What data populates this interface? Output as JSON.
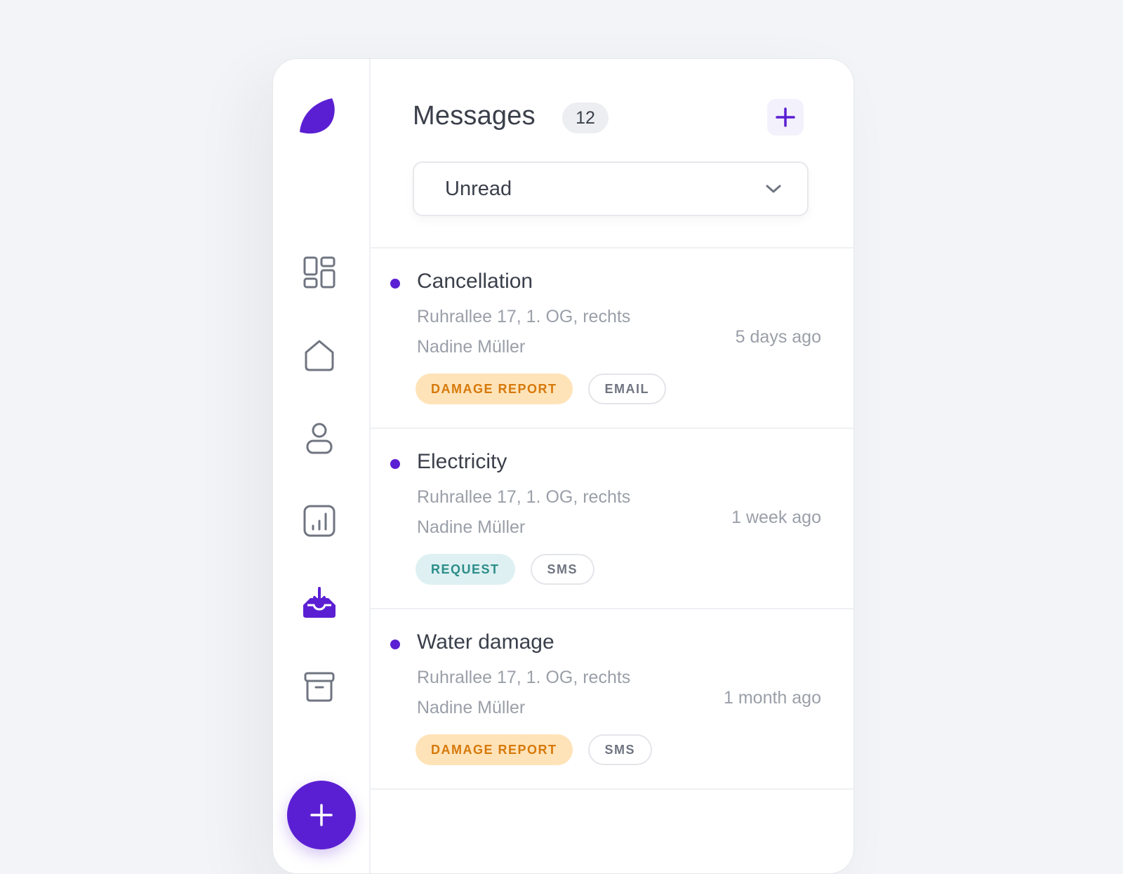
{
  "colors": {
    "accent": "#5b1fd3",
    "damage_tag_bg": "#ffe3b8",
    "damage_tag_text": "#d6790a",
    "request_tag_bg": "#def0f2",
    "request_tag_text": "#2c8d89"
  },
  "sidebar": {
    "logo": "leaf-logo-icon",
    "nav": [
      {
        "icon": "dashboard-icon",
        "active": false
      },
      {
        "icon": "home-icon",
        "active": false
      },
      {
        "icon": "user-icon",
        "active": false
      },
      {
        "icon": "chart-icon",
        "active": false
      },
      {
        "icon": "inbox-icon",
        "active": true
      },
      {
        "icon": "archive-icon",
        "active": false
      }
    ],
    "fab_icon": "plus-icon"
  },
  "header": {
    "title": "Messages",
    "count": "12",
    "add_icon": "plus-icon"
  },
  "filter": {
    "selected": "Unread",
    "icon": "chevron-down-icon"
  },
  "messages": [
    {
      "title": "Cancellation",
      "address": "Ruhrallee 17, 1. OG, rechts",
      "name": "Nadine Müller",
      "time": "5 days ago",
      "tags": [
        "DAMAGE REPORT",
        "EMAIL"
      ]
    },
    {
      "title": "Electricity",
      "address": "Ruhrallee 17, 1. OG, rechts",
      "name": "Nadine Müller",
      "time": "1 week ago",
      "tags": [
        "REQUEST",
        "SMS"
      ]
    },
    {
      "title": "Water damage",
      "address": "Ruhrallee 17, 1. OG, rechts",
      "name": "Nadine Müller",
      "time": "1 month ago",
      "tags": [
        "DAMAGE REPORT",
        "SMS"
      ]
    }
  ]
}
